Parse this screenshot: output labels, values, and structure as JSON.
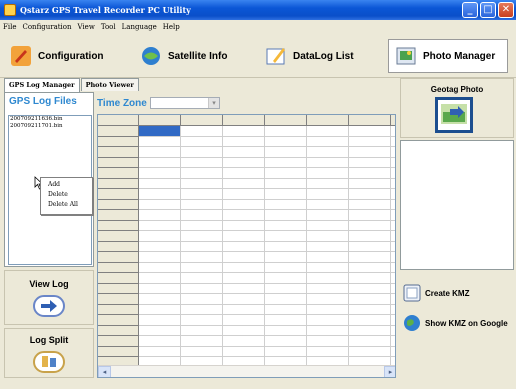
{
  "window": {
    "title": "Qstarz GPS Travel Recorder PC Utility",
    "controls": [
      "minimize",
      "maximize",
      "close"
    ]
  },
  "menu": [
    "File",
    "Configuration",
    "View",
    "Tool",
    "Language",
    "Help"
  ],
  "toolbar": {
    "configuration": "Configuration",
    "satellite_info": "Satellite Info",
    "datalog_list": "DataLog List",
    "photo_manager": "Photo Manager"
  },
  "tabs": [
    "GPS Log Manager",
    "Photo Viewer"
  ],
  "gps_files": {
    "title": "GPS Log Files",
    "files": [
      "20070921163​6.bin",
      "20070921170​1.bin"
    ]
  },
  "context_menu": [
    "Add",
    "Delete",
    "Delete All"
  ],
  "time_zone": {
    "label": "Time Zone",
    "value": ""
  },
  "buttons": {
    "view_log": "View Log",
    "log_split": "Log Split",
    "geotag_photo": "Geotag Photo",
    "create_kmz": "Create KMZ",
    "show_kmz": "Show KMZ on Google"
  }
}
